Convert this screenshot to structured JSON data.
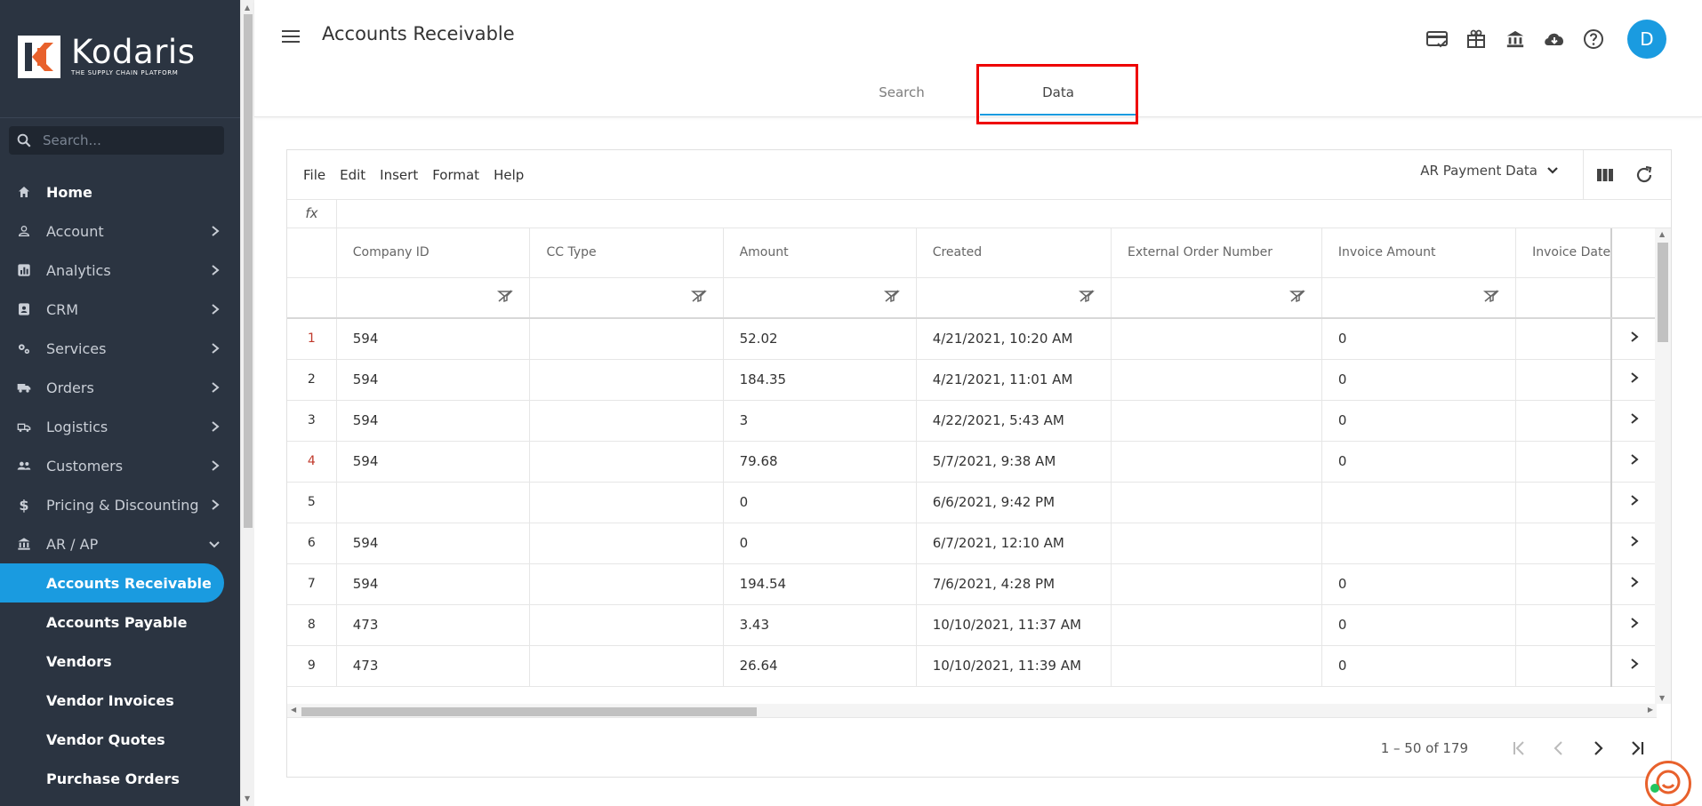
{
  "app": {
    "logo_word": "Kodaris",
    "logo_tagline": "THE SUPPLY CHAIN PLATFORM",
    "accent_color": "#1a9be0",
    "sidebar_color": "#2b3441"
  },
  "sidebar": {
    "search_placeholder": "Search...",
    "items": [
      {
        "label": "Home",
        "icon": "home-icon"
      },
      {
        "label": "Account",
        "icon": "person-icon"
      },
      {
        "label": "Analytics",
        "icon": "analytics-icon"
      },
      {
        "label": "CRM",
        "icon": "contact-icon"
      },
      {
        "label": "Services",
        "icon": "gears-icon"
      },
      {
        "label": "Orders",
        "icon": "truck-icon"
      },
      {
        "label": "Logistics",
        "icon": "shipping-icon"
      },
      {
        "label": "Customers",
        "icon": "people-icon"
      },
      {
        "label": "Pricing & Discounting",
        "icon": "dollar-icon"
      },
      {
        "label": "AR / AP",
        "icon": "bank-icon"
      }
    ],
    "sub_items": [
      {
        "label": "Accounts Receivable",
        "active": true
      },
      {
        "label": "Accounts Payable"
      },
      {
        "label": "Vendors"
      },
      {
        "label": "Vendor Invoices"
      },
      {
        "label": "Vendor Quotes"
      },
      {
        "label": "Purchase Orders"
      }
    ]
  },
  "header": {
    "title": "Accounts Receivable",
    "avatar_initial": "D",
    "icons": [
      "card-check-icon",
      "gift-icon",
      "bank-icon",
      "cloud-download-icon",
      "help-icon"
    ],
    "tabs": [
      {
        "label": "Search"
      },
      {
        "label": "Data",
        "active": true
      }
    ]
  },
  "grid": {
    "menu": [
      "File",
      "Edit",
      "Insert",
      "Format",
      "Help"
    ],
    "dataset": "AR Payment Data",
    "fx_label": "fx",
    "columns": [
      "Company ID",
      "CC Type",
      "Amount",
      "Created",
      "External Order Number",
      "Invoice Amount",
      "Invoice Date"
    ],
    "rows": [
      {
        "n": "1",
        "company_id": "594",
        "cc_type": "",
        "amount": "52.02",
        "created": "4/21/2021, 10:20 AM",
        "ext_order": "",
        "invoice_amount": "0"
      },
      {
        "n": "2",
        "company_id": "594",
        "cc_type": "",
        "amount": "184.35",
        "created": "4/21/2021, 11:01 AM",
        "ext_order": "",
        "invoice_amount": "0"
      },
      {
        "n": "3",
        "company_id": "594",
        "cc_type": "",
        "amount": "3",
        "created": "4/22/2021, 5:43 AM",
        "ext_order": "",
        "invoice_amount": "0"
      },
      {
        "n": "4",
        "company_id": "594",
        "cc_type": "",
        "amount": "79.68",
        "created": "5/7/2021, 9:38 AM",
        "ext_order": "",
        "invoice_amount": "0"
      },
      {
        "n": "5",
        "company_id": "",
        "cc_type": "",
        "amount": "0",
        "created": "6/6/2021, 9:42 PM",
        "ext_order": "",
        "invoice_amount": ""
      },
      {
        "n": "6",
        "company_id": "594",
        "cc_type": "",
        "amount": "0",
        "created": "6/7/2021, 12:10 AM",
        "ext_order": "",
        "invoice_amount": ""
      },
      {
        "n": "7",
        "company_id": "594",
        "cc_type": "",
        "amount": "194.54",
        "created": "7/6/2021, 4:28 PM",
        "ext_order": "",
        "invoice_amount": "0"
      },
      {
        "n": "8",
        "company_id": "473",
        "cc_type": "",
        "amount": "3.43",
        "created": "10/10/2021, 11:37 AM",
        "ext_order": "",
        "invoice_amount": "0"
      },
      {
        "n": "9",
        "company_id": "473",
        "cc_type": "",
        "amount": "26.64",
        "created": "10/10/2021, 11:39 AM",
        "ext_order": "",
        "invoice_amount": "0"
      }
    ],
    "pagination": "1 – 50 of 179"
  }
}
